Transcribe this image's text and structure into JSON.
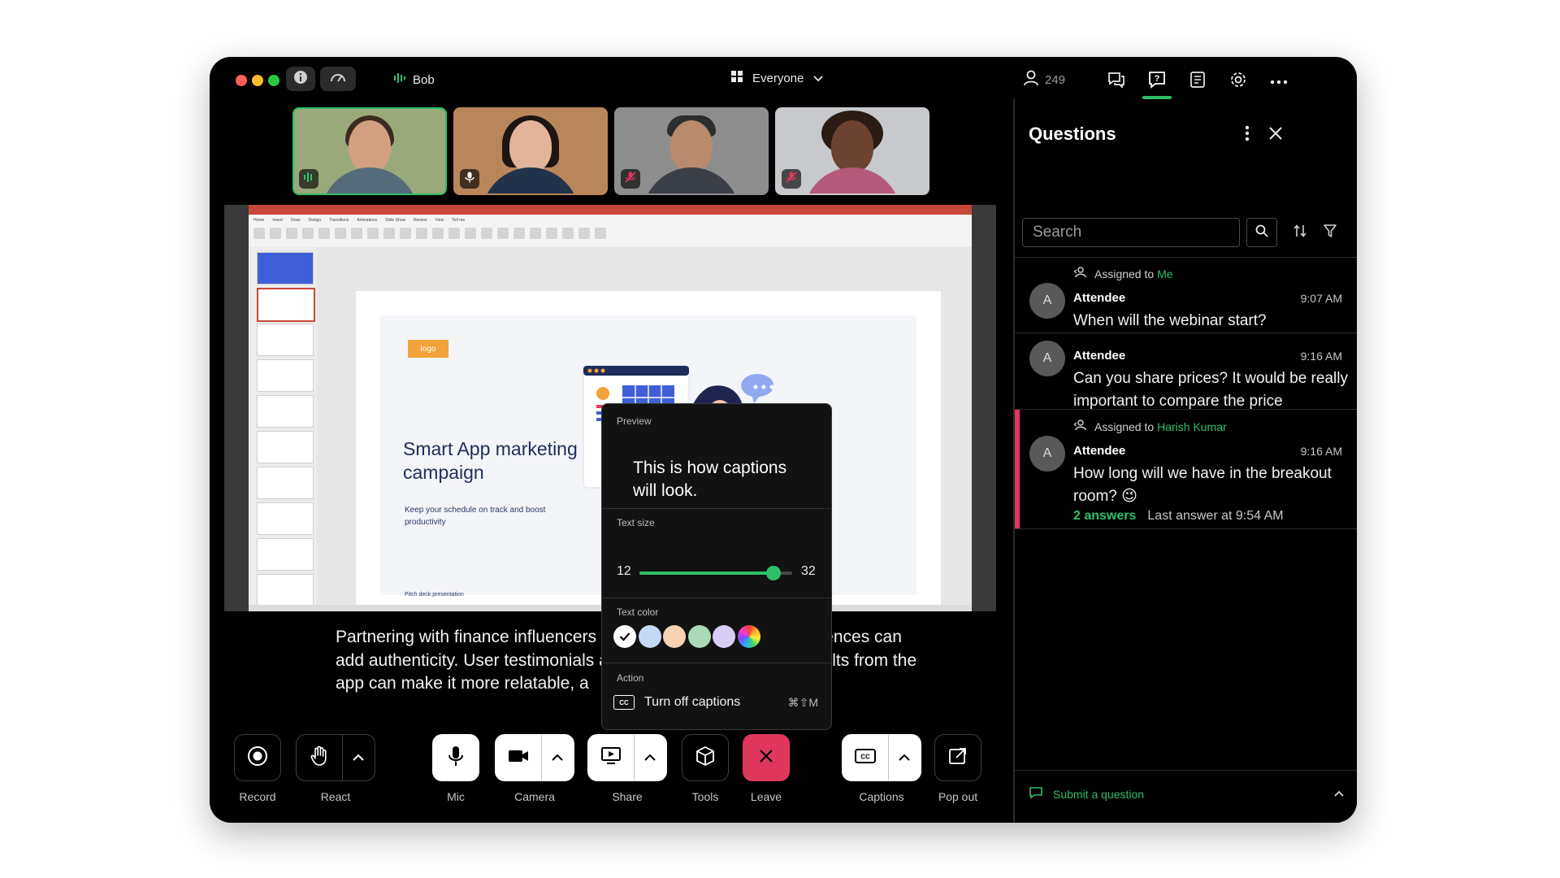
{
  "titlebar": {
    "speaker_name": "Bob",
    "layout_label": "Everyone",
    "participant_count": "249"
  },
  "thumbnails": [
    {
      "mic": "speaking",
      "skin": "#d2a07e",
      "hair": "#3b2a20",
      "shirt": "#556b7a",
      "bg": "#9aa97a"
    },
    {
      "mic": "on",
      "skin": "#e2b59a",
      "hair": "#1d1512",
      "shirt": "#21324a",
      "bg": "#b9865c"
    },
    {
      "mic": "muted",
      "skin": "#b98a6c",
      "hair": "#2d2d2d",
      "shirt": "#3a3f48",
      "bg": "#8d8d8d"
    },
    {
      "mic": "muted",
      "skin": "#6b4330",
      "hair": "#2a1c14",
      "shirt": "#b45a7a",
      "bg": "#c7c9cc"
    }
  ],
  "slide": {
    "logo": "logo",
    "title": "Smart App marketing campaign",
    "subtitle": "Keep your schedule on track and boost productivity",
    "footer": "Pitch deck presentation",
    "ribbon_tabs": [
      "Home",
      "Insert",
      "Draw",
      "Design",
      "Transitions",
      "Animations",
      "Slide Show",
      "Review",
      "View",
      "Tell me"
    ]
  },
  "caption": {
    "text": "Partnering with finance influencers who resonate with target audiences can add authenticity. User testimonials and case studies showing results from the app can make it more relatable, a"
  },
  "popover": {
    "preview_label": "Preview",
    "preview_text": "This is how captions will look.",
    "text_size_label": "Text size",
    "size_min": "12",
    "size_max": "32",
    "size_value_fraction": 0.88,
    "text_color_label": "Text color",
    "colors": [
      "#ffffff",
      "#c5d9f7",
      "#f7d2b3",
      "#a9d9b6",
      "#d9cdf5",
      "rainbow"
    ],
    "selected_color_index": 0,
    "action_label": "Action",
    "action_item": "Turn off captions",
    "action_shortcut": "⌘⇧M"
  },
  "controls": {
    "record": "Record",
    "react": "React",
    "mic": "Mic",
    "camera": "Camera",
    "share": "Share",
    "tools": "Tools",
    "leave": "Leave",
    "captions": "Captions",
    "popout": "Pop out",
    "leave_color": "#e0375f"
  },
  "questions": {
    "title": "Questions",
    "search_placeholder": "Search",
    "items": [
      {
        "assigned_prefix": "Assigned to",
        "assigned_to": "Me",
        "avatar": "A",
        "author": "Attendee",
        "time": "9:07 AM",
        "text": "When will the webinar start?"
      },
      {
        "avatar": "A",
        "author": "Attendee",
        "time": "9:16 AM",
        "text": "Can you share prices? It would be really important to compare the price"
      },
      {
        "assigned_prefix": "Assigned to",
        "assigned_to": "Harish Kumar",
        "avatar": "A",
        "author": "Attendee",
        "time": "9:16 AM",
        "text": "How long will we have in the breakout room? 😉",
        "answers": "2 answers",
        "last_answer": "Last answer at 9:54 AM"
      }
    ],
    "submit_label": "Submit a question"
  },
  "colors": {
    "accent_green": "#2fbf6a",
    "highlight_pink": "#e0375f"
  }
}
